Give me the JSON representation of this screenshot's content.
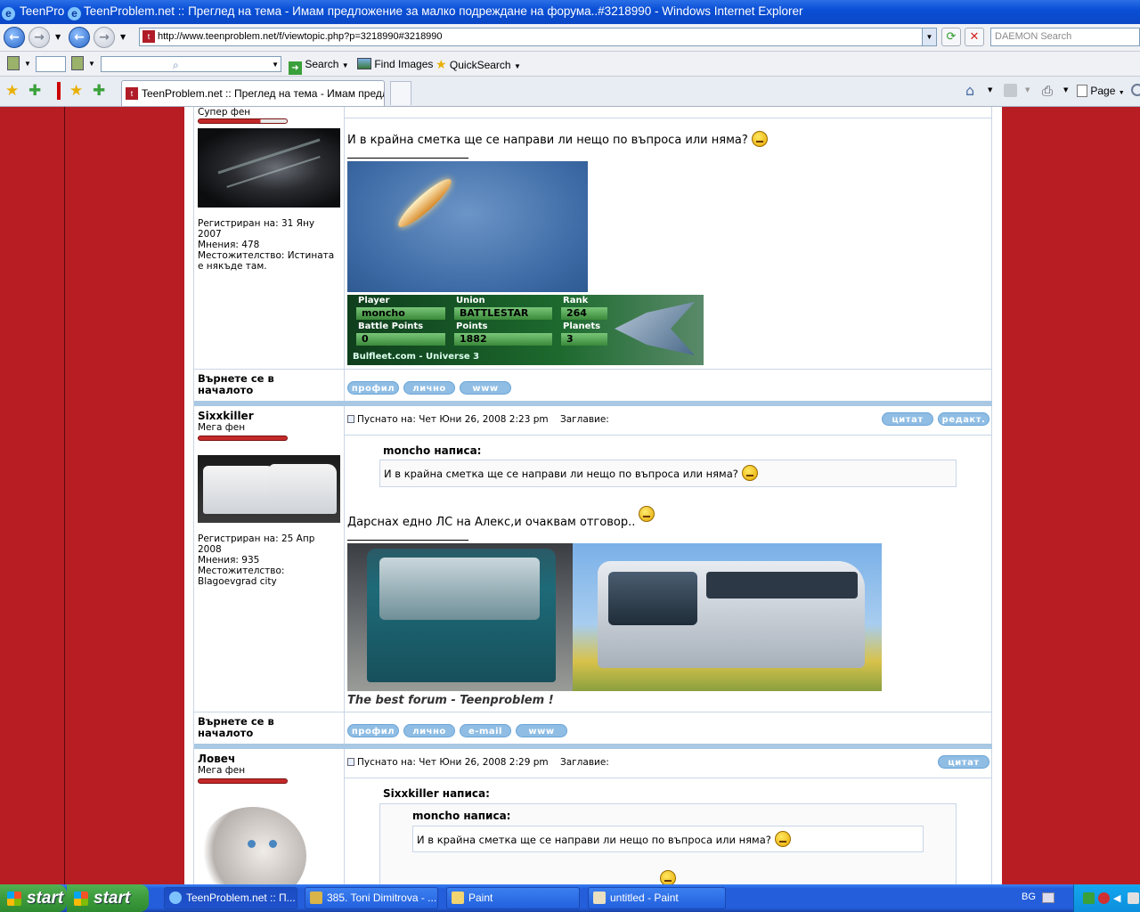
{
  "window": {
    "title_tab_text": "TeenPro",
    "title": "TeenProblem.net :: Преглед на тема - Имам предложение за малко подреждане на форума..#3218990 - Windows Internet Explorer"
  },
  "address_bar": {
    "url": "http://www.teenproblem.net/f/viewtopic.php?p=3218990#3218990"
  },
  "search_box": {
    "placeholder": "DAEMON Search"
  },
  "toolbar": {
    "search_label": "Search",
    "find_images_label": "Find Images",
    "quicksearch_label": "QuickSearch"
  },
  "tabs": {
    "active_label": "TeenProblem.net :: Преглед на тема - Имам предло..."
  },
  "command_bar": {
    "page_label": "Page"
  },
  "posts": [
    {
      "rank": "Супер фен",
      "registered": "Регистриран на: 31 Яну 2007",
      "posts_count": "Мнения: 478",
      "location": "Местожителство: Истината е някъде там.",
      "text": "И в крайна сметка ще се направи ли нещо по въпроса или няма?",
      "back_label": "Върнете се в началото",
      "buttons": [
        "профил",
        "лично",
        "www"
      ],
      "banner": {
        "player_label": "Player",
        "player": "moncho",
        "union_label": "Union",
        "union": "BATTLESTAR",
        "rank_label": "Rank",
        "rank": "264",
        "battle_label": "Battle Points",
        "battle": "0",
        "points_label": "Points",
        "points": "1882",
        "planets_label": "Planets",
        "planets": "3",
        "footer": "Bulfleet.com - Universe 3"
      }
    },
    {
      "username": "Sixxkiller",
      "rank": "Мега фен",
      "registered": "Регистриран на: 25 Апр 2008",
      "posts_count": "Мнения: 935",
      "location": "Местожителство: Blagoevgrad city",
      "posted": "Пуснато на: Чет Юни 26, 2008 2:23 pm",
      "subject_label": "Заглавие:",
      "quote_button": "цитат",
      "edit_button": "редакт.",
      "quote_author": "moncho написа:",
      "quote_text": "И в крайна сметка ще се направи ли нещо по въпроса или няма?",
      "text": "Дарснах едно ЛС на Алекс,и очаквам отговор..",
      "signature": "The best forum - Teenproblem !",
      "back_label": "Върнете се в началото",
      "buttons": [
        "профил",
        "лично",
        "e-mail",
        "www"
      ]
    },
    {
      "username": "Ловеч",
      "rank": "Мега фен",
      "posted": "Пуснато на: Чет Юни 26, 2008 2:29 pm",
      "subject_label": "Заглавие:",
      "quote_button": "цитат",
      "quote_author": "Sixxkiller написа:",
      "inner_quote_author": "moncho написа:",
      "inner_quote_text": "И в крайна сметка ще се направи ли нещо по въпроса или няма?"
    }
  ],
  "taskbar": {
    "start_label": "start",
    "items": [
      "TeenProblem.net :: П...",
      "385. Toni Dimitrova - ...",
      "Paint",
      "untitled - Paint"
    ],
    "language": "BG"
  },
  "colors": {
    "page_background": "#b81d24",
    "accent": "#8fbde4",
    "title_bar": "#0b47c6"
  }
}
